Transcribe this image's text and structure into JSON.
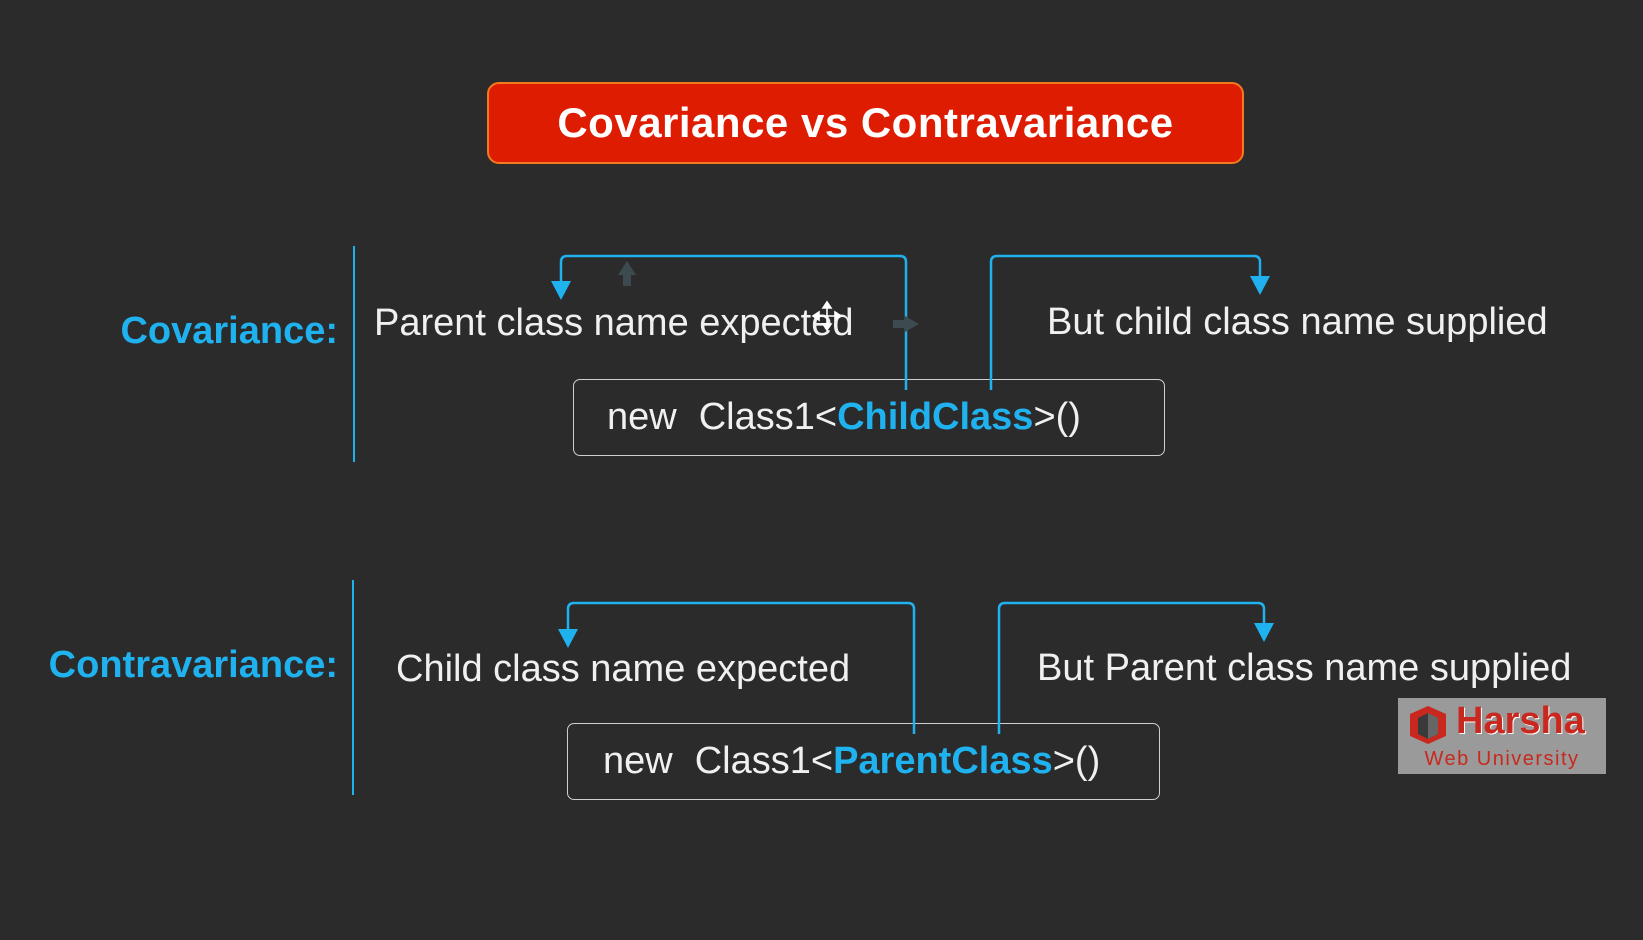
{
  "title": "Covariance vs Contravariance",
  "covariance": {
    "label": "Covariance:",
    "expected_text": "Parent class name expected",
    "supplied_text": "But child class name supplied",
    "code": {
      "prefix": "new",
      "class_open": "Class1<",
      "type_arg": "ChildClass",
      "class_close": ">()"
    }
  },
  "contravariance": {
    "label": "Contravariance:",
    "expected_text": "Child class name expected",
    "supplied_text": "But Parent class name supplied",
    "code": {
      "prefix": "new",
      "class_open": "Class1<",
      "type_arg": "ParentClass",
      "class_close": ">()"
    }
  },
  "logo": {
    "name": "Harsha",
    "subtitle": "Web University"
  },
  "colors": {
    "background": "#2b2b2b",
    "title_bg": "#dd1c02",
    "accent": "#1fb2ee",
    "text": "#f0f0f0"
  },
  "icons": [
    "move-cursor-icon",
    "arrow-down-icon",
    "harsha-logo-icon"
  ]
}
